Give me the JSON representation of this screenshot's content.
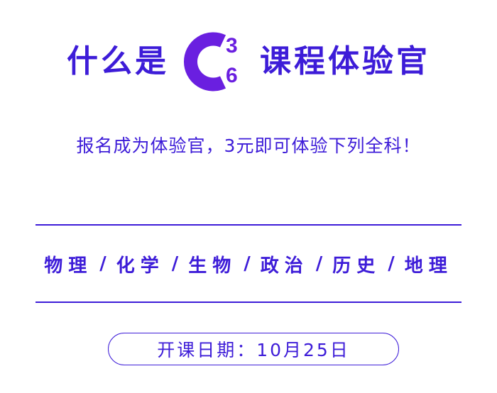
{
  "header": {
    "title_prefix": "什么是",
    "title_suffix": "课程体验官",
    "logo_letter": "C",
    "logo_superscript": "3",
    "logo_subscript": "6"
  },
  "subtitle": "报名成为体验官，3元即可体验下列全科！",
  "subjects": {
    "separator": "/",
    "items": [
      "物理",
      "化学",
      "生物",
      "政治",
      "历史",
      "地理"
    ]
  },
  "date_pill": {
    "text": "开课日期：10月25日"
  },
  "colors": {
    "primary": "#3d1cd8",
    "logo": "#6a1fe0",
    "background": "#ffffff"
  }
}
